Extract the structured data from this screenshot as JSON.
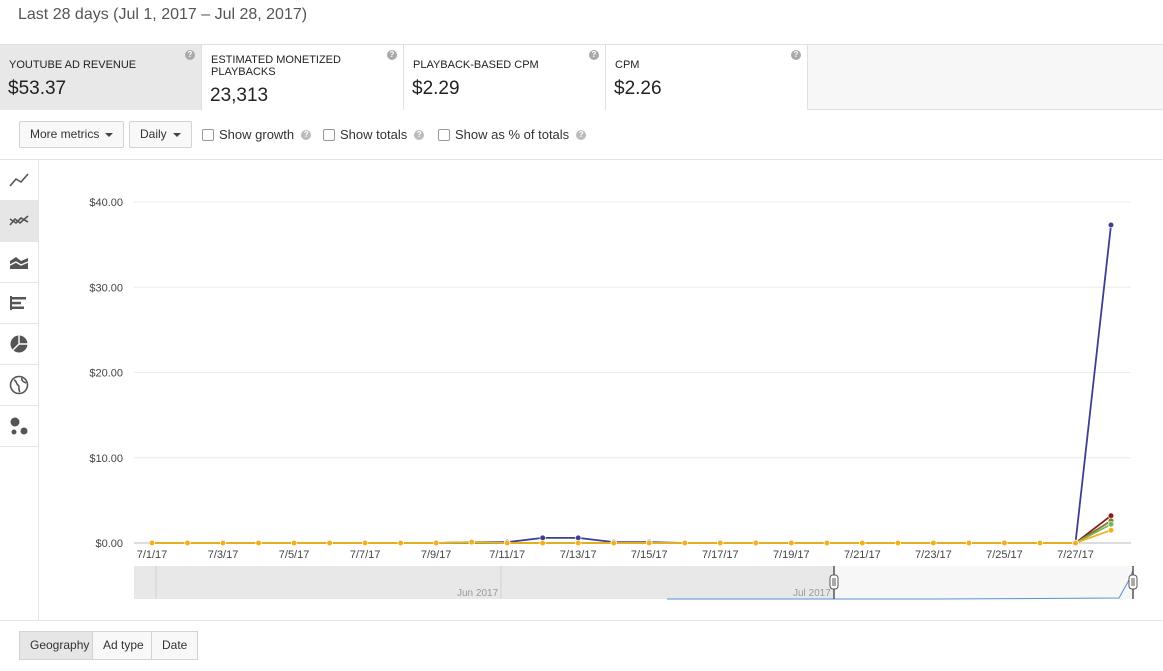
{
  "header": {
    "date_range": "Last 28 days (Jul 1, 2017 – Jul 28, 2017)"
  },
  "metrics": [
    {
      "label": "YOUTUBE AD REVENUE",
      "value": "$53.37",
      "selected": true
    },
    {
      "label": "ESTIMATED MONETIZED PLAYBACKS",
      "value": "23,313",
      "selected": false
    },
    {
      "label": "PLAYBACK-BASED CPM",
      "value": "$2.29",
      "selected": false
    },
    {
      "label": "CPM",
      "value": "$2.26",
      "selected": false
    }
  ],
  "toolbar": {
    "more_metrics": "More metrics",
    "interval": "Daily",
    "show_growth": "Show growth",
    "show_totals": "Show totals",
    "show_percent": "Show as % of totals"
  },
  "sidebar": [
    "line-chart-icon",
    "multi-line-chart-icon",
    "stacked-area-chart-icon",
    "bar-chart-icon",
    "pie-chart-icon",
    "globe-map-icon",
    "bubble-chart-icon"
  ],
  "chart_data": {
    "type": "line",
    "x": [
      "7/1/17",
      "7/2/17",
      "7/3/17",
      "7/4/17",
      "7/5/17",
      "7/6/17",
      "7/7/17",
      "7/8/17",
      "7/9/17",
      "7/10/17",
      "7/11/17",
      "7/12/17",
      "7/13/17",
      "7/14/17",
      "7/15/17",
      "7/16/17",
      "7/17/17",
      "7/18/17",
      "7/19/17",
      "7/20/17",
      "7/21/17",
      "7/22/17",
      "7/23/17",
      "7/24/17",
      "7/25/17",
      "7/26/17",
      "7/27/17",
      "7/28/17"
    ],
    "x_tick_labels": [
      "7/1/17",
      "7/3/17",
      "7/5/17",
      "7/7/17",
      "7/9/17",
      "7/11/17",
      "7/13/17",
      "7/15/17",
      "7/17/17",
      "7/19/17",
      "7/21/17",
      "7/23/17",
      "7/25/17",
      "7/27/17"
    ],
    "y_tick_labels": [
      "$0.00",
      "$10.00",
      "$20.00",
      "$30.00",
      "$40.00"
    ],
    "ylim": [
      0,
      40
    ],
    "grid": true,
    "series": [
      {
        "color": "#3f3f8f",
        "values": [
          0,
          0,
          0,
          0,
          0,
          0,
          0,
          0,
          0,
          0.1,
          0.1,
          0.6,
          0.6,
          0.1,
          0.1,
          0,
          0,
          0,
          0,
          0,
          0,
          0,
          0,
          0,
          0,
          0,
          0,
          37.3
        ]
      },
      {
        "color": "#8b1c1c",
        "values": [
          0,
          0,
          0,
          0,
          0,
          0,
          0,
          0,
          0,
          0,
          0,
          0,
          0,
          0,
          0,
          0,
          0,
          0,
          0,
          0,
          0,
          0,
          0,
          0,
          0,
          0,
          0,
          3.2
        ]
      },
      {
        "color": "#7a7a3a",
        "values": [
          0,
          0,
          0,
          0,
          0,
          0,
          0,
          0,
          0,
          0,
          0,
          0,
          0,
          0,
          0,
          0,
          0,
          0,
          0,
          0,
          0,
          0,
          0,
          0,
          0,
          0,
          0,
          2.6
        ]
      },
      {
        "color": "#7ab648",
        "values": [
          0,
          0,
          0,
          0,
          0,
          0,
          0,
          0,
          0,
          0,
          0,
          0,
          0,
          0,
          0,
          0,
          0,
          0,
          0,
          0,
          0,
          0,
          0,
          0,
          0,
          0,
          0,
          2.2
        ]
      },
      {
        "color": "#f2b01e",
        "values": [
          0,
          0,
          0,
          0,
          0,
          0,
          0,
          0,
          0,
          0.1,
          0,
          0,
          0,
          0,
          0,
          0,
          0,
          0,
          0,
          0,
          0,
          0,
          0,
          0,
          0,
          0,
          0,
          1.5
        ]
      }
    ]
  },
  "navigator": {
    "label_left": "Jun 2017",
    "label_right": "Jul 2017"
  },
  "bottom_tabs": [
    "Geography",
    "Ad type",
    "Date"
  ]
}
